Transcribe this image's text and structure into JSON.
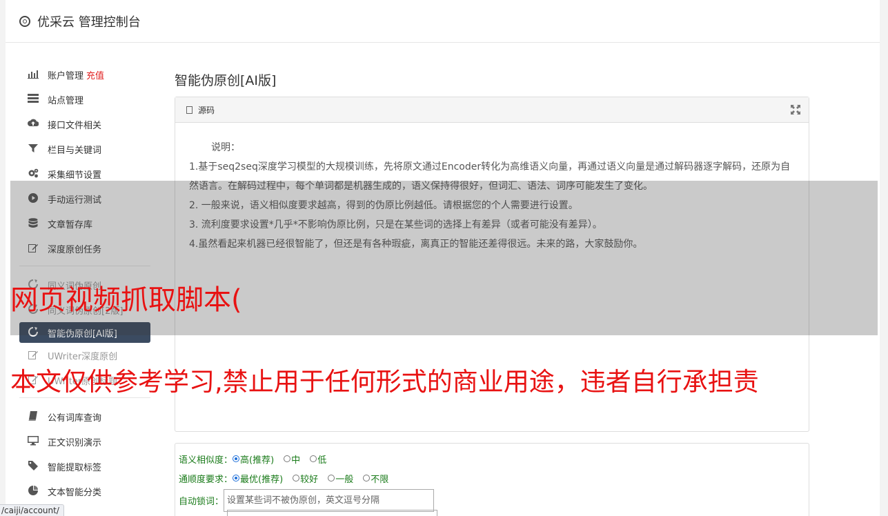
{
  "header": {
    "title": "优采云 管理控制台",
    "icon": "gear-icon"
  },
  "sidebar": {
    "group1": [
      {
        "label": "账户管理",
        "extra": "充值",
        "icon": "bar-chart-icon"
      },
      {
        "label": "站点管理",
        "icon": "server-icon"
      },
      {
        "label": "接口文件相关",
        "icon": "cloud-upload-icon"
      },
      {
        "label": "栏目与关键词",
        "icon": "filter-icon"
      },
      {
        "label": "采集细节设置",
        "icon": "cogs-icon"
      },
      {
        "label": "手动运行测试",
        "icon": "play-circle-icon"
      },
      {
        "label": "文章暂存库",
        "icon": "database-icon"
      },
      {
        "label": "深度原创任务",
        "icon": "edit-icon"
      }
    ],
    "group2": [
      {
        "label": "同义词伪原创",
        "icon": "refresh-icon"
      },
      {
        "label": "同义词伪原创[2版]",
        "icon": "refresh-icon"
      },
      {
        "label": "智能伪原创[AI版]",
        "icon": "refresh-icon",
        "active": true
      },
      {
        "label": "UWriter深度原创",
        "icon": "edit-icon"
      },
      {
        "label": "UWriter原创标题",
        "icon": "edit-icon"
      }
    ],
    "group3": [
      {
        "label": "公有词库查询",
        "icon": "book-icon"
      },
      {
        "label": "正文识别演示",
        "icon": "monitor-icon"
      },
      {
        "label": "智能提取标签",
        "icon": "tag-icon"
      },
      {
        "label": "文本智能分类",
        "icon": "pie-chart-icon"
      }
    ]
  },
  "main": {
    "title": "智能伪原创[AI版]",
    "panel": {
      "header_label": "源码",
      "intro": "说明：",
      "lines": [
        "1.基于seq2seq深度学习模型的大规模训练，先将原文通过Encoder转化为高维语义向量，再通过语义向量是通过解码器逐字解码，还原为自然语言。在解码过程中，每个单词都是机器生成的，语义保持得很好，但词汇、语法、词序可能发生了变化。",
        "2. 一般来说，语义相似度要求越高，得到的伪原比例越低。请根据您的个人需要进行设置。",
        "3. 流利度要求设置*几乎*不影响伪原比例，只是在某些词的选择上有差异（或者可能没有差异）。",
        "4.虽然看起来机器已经很智能了，但还是有各种瑕疵，离真正的智能还差得很远。未来的路，大家鼓励你。"
      ]
    },
    "form": {
      "similarity": {
        "label": "语义相似度：",
        "options": [
          "高(推荐)",
          "中",
          "低"
        ],
        "selected": "高(推荐)"
      },
      "fluency": {
        "label": "通顺度要求：",
        "options": [
          "最优(推荐)",
          "较好",
          "一般",
          "不限"
        ],
        "selected": "最优(推荐)"
      },
      "lock_words": {
        "label": "自动锁词：",
        "value": "",
        "placeholder": "设置某些词不被伪原创，英文逗号分隔"
      }
    }
  },
  "watermark": {
    "line1": "网页视频抓取脚本(",
    "line2": "本文仅供参考学习,禁止用于任何形式的商业用途，违者自行承担责"
  },
  "status_bar": {
    "url": "/caiji/account/"
  }
}
